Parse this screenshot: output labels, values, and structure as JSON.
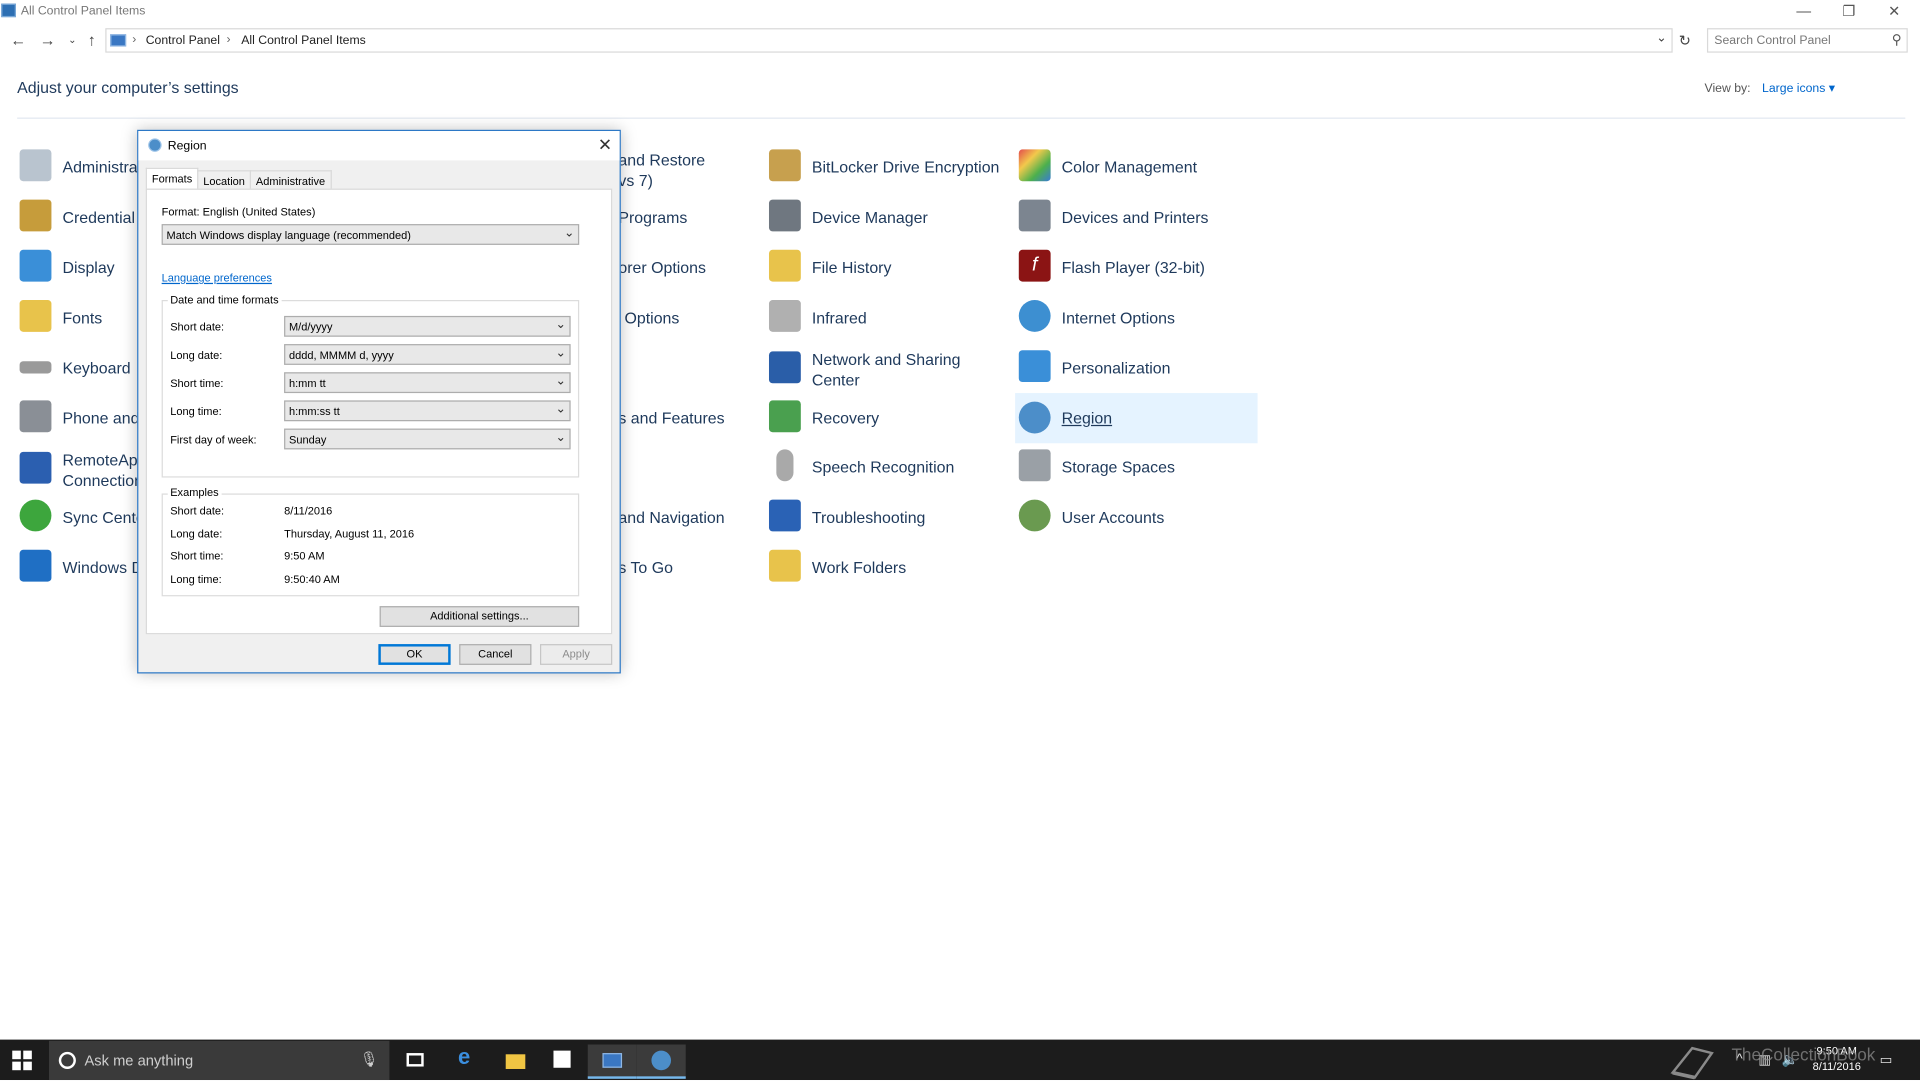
{
  "window": {
    "title": "All Control Panel Items",
    "controls": {
      "minimize": "—",
      "restore": "❐",
      "close": "✕"
    }
  },
  "address": {
    "crumbs": [
      "Control Panel",
      "All Control Panel Items"
    ],
    "sep": "›",
    "search_placeholder": "Search Control Panel"
  },
  "main": {
    "heading": "Adjust your computer’s settings",
    "view_by_label": "View by:",
    "view_by_value": "Large icons ▾"
  },
  "items": [
    {
      "label": "Administra"
    },
    {
      "label": "Credential"
    },
    {
      "label": "Display"
    },
    {
      "label": "Fonts"
    },
    {
      "label": "Keyboard"
    },
    {
      "label": "Phone and"
    },
    {
      "label": "RemoteApp\nConnection"
    },
    {
      "label": "Sync Cente"
    },
    {
      "label": "Windows D"
    },
    {
      "label": "and Restore\nvs 7)"
    },
    {
      "label": "Programs"
    },
    {
      "label": "orer Options"
    },
    {
      "label": "Options"
    },
    {
      "label": "s and Features"
    },
    {
      "label": "and Navigation"
    },
    {
      "label": "s To Go"
    },
    {
      "label": "BitLocker Drive Encryption"
    },
    {
      "label": "Device Manager"
    },
    {
      "label": "File History"
    },
    {
      "label": "Infrared"
    },
    {
      "label": "Network and Sharing\nCenter"
    },
    {
      "label": "Recovery"
    },
    {
      "label": "Speech Recognition"
    },
    {
      "label": "Troubleshooting"
    },
    {
      "label": "Work Folders"
    },
    {
      "label": "Color Management"
    },
    {
      "label": "Devices and Printers"
    },
    {
      "label": "Flash Player (32-bit)"
    },
    {
      "label": "Internet Options"
    },
    {
      "label": "Personalization"
    },
    {
      "label": "Region"
    },
    {
      "label": "Storage Spaces"
    },
    {
      "label": "User Accounts"
    }
  ],
  "dialog": {
    "title": "Region",
    "close": "✕",
    "tabs": [
      "Formats",
      "Location",
      "Administrative"
    ],
    "format_label": "Format: English (United States)",
    "format_value": "Match Windows display language (recommended)",
    "language_link": "Language preferences",
    "dt_group": "Date and time formats",
    "short_date_label": "Short date:",
    "short_date_value": "M/d/yyyy",
    "long_date_label": "Long date:",
    "long_date_value": "dddd, MMMM d, yyyy",
    "short_time_label": "Short time:",
    "short_time_value": "h:mm tt",
    "long_time_label": "Long time:",
    "long_time_value": "h:mm:ss tt",
    "first_day_label": "First day of week:",
    "first_day_value": "Sunday",
    "examples_group": "Examples",
    "ex_short_date_label": "Short date:",
    "ex_short_date": "8/11/2016",
    "ex_long_date_label": "Long date:",
    "ex_long_date": "Thursday, August 11, 2016",
    "ex_short_time_label": "Short time:",
    "ex_short_time": "9:50 AM",
    "ex_long_time_label": "Long time:",
    "ex_long_time": "9:50:40 AM",
    "additional": "Additional settings...",
    "ok": "OK",
    "cancel": "Cancel",
    "apply": "Apply"
  },
  "taskbar": {
    "search_placeholder": "Ask me anything",
    "time": "9:50 AM",
    "date": "8/11/2016"
  },
  "watermark": "TheCollectionBook"
}
